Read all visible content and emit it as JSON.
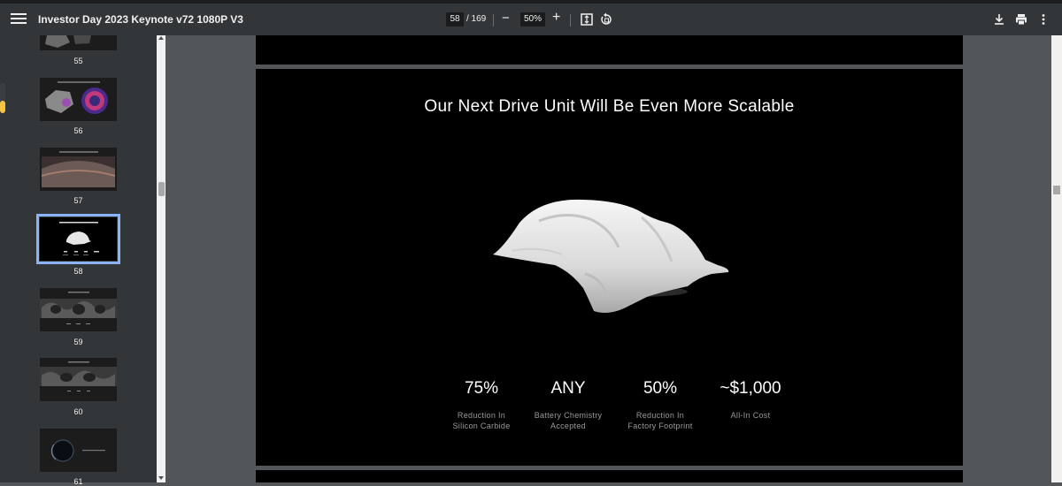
{
  "toolbar": {
    "title": "Investor Day 2023 Keynote v72 1080P V3",
    "page_current": "58",
    "page_total": "/ 169",
    "zoom": "50%"
  },
  "sidebar": {
    "thumbnails": [
      {
        "label": "55"
      },
      {
        "label": "56"
      },
      {
        "label": "57"
      },
      {
        "label": "58"
      },
      {
        "label": "59"
      },
      {
        "label": "60"
      },
      {
        "label": "61"
      }
    ]
  },
  "slide": {
    "title": "Our Next Drive Unit Will Be Even More Scalable",
    "stats": [
      {
        "value": "75%",
        "caption_line1": "Reduction In",
        "caption_line2": "Silicon Carbide"
      },
      {
        "value": "ANY",
        "caption_line1": "Battery Chemistry",
        "caption_line2": "Accepted"
      },
      {
        "value": "50%",
        "caption_line1": "Reduction In",
        "caption_line2": "Factory Footprint"
      },
      {
        "value": "~$1,000",
        "caption_line1": "All-In Cost",
        "caption_line2": ""
      }
    ]
  },
  "colors": {
    "toolbar_bg": "#323639",
    "viewer_bg": "#525659",
    "selection_outline": "#8ab4f8",
    "slide_bg": "#000000"
  },
  "icons": [
    "menu-icon",
    "fit-page-icon",
    "rotate-icon",
    "download-icon",
    "print-icon",
    "more-vert-icon"
  ]
}
